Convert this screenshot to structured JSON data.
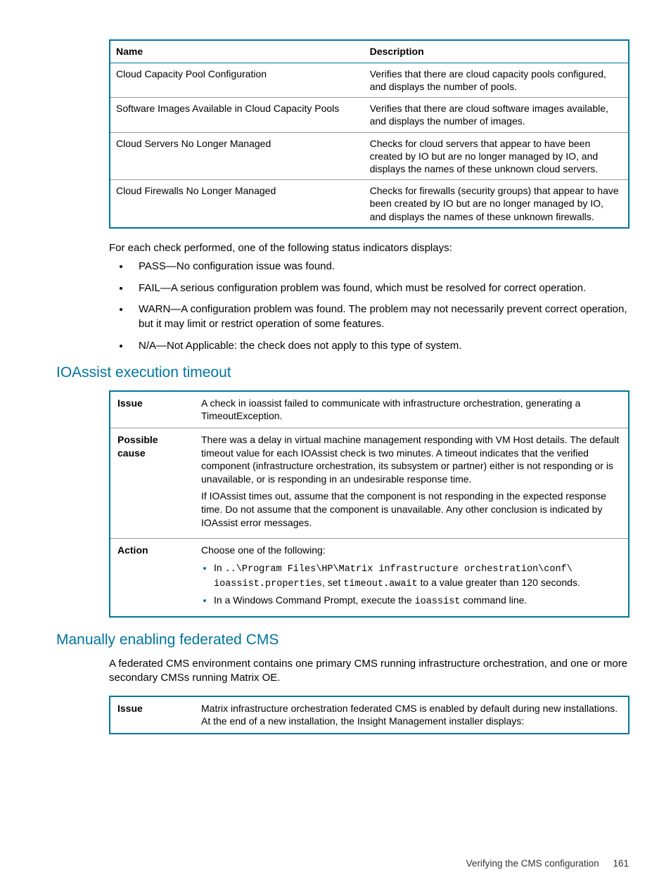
{
  "table1": {
    "header_name": "Name",
    "header_desc": "Description",
    "rows": [
      {
        "name": "Cloud Capacity Pool Configuration",
        "desc": "Verifies that there are cloud capacity pools configured, and displays the number of pools."
      },
      {
        "name": "Software Images Available in Cloud Capacity Pools",
        "desc": "Verifies that there are cloud software images available, and displays the number of images."
      },
      {
        "name": "Cloud Servers No Longer Managed",
        "desc": "Checks for cloud servers that appear to have been created by IO but are no longer managed by IO, and displays the names of these unknown cloud servers."
      },
      {
        "name": "Cloud Firewalls No Longer Managed",
        "desc": "Checks for firewalls (security groups) that appear to have been created by IO but are no longer managed by IO, and displays the names of these unknown firewalls."
      }
    ]
  },
  "para_intro": "For each check performed, one of the following status indicators displays:",
  "statuses": [
    "PASS—No configuration issue was found.",
    "FAIL—A serious configuration problem was found, which must be resolved for correct operation.",
    "WARN—A configuration problem was found. The problem may not necessarily prevent correct operation, but it may limit or restrict operation of some features.",
    "N/A—Not Applicable: the check does not apply to this type of system."
  ],
  "h_timeout": "IOAssist execution timeout",
  "table2": {
    "issue_label": "Issue",
    "issue_text": "A check in ioassist failed to communicate with infrastructure orchestration, generating a TimeoutException.",
    "cause_label": "Possible cause",
    "cause_p1": "There was a delay in virtual machine management responding with VM Host details. The default timeout value for each IOAssist check is two minutes. A timeout indicates that the verified component (infrastructure orchestration, its subsystem or partner) either is not responding or is unavailable, or is responding in an undesirable response time.",
    "cause_p2": "If IOAssist times out, assume that the component is not responding in the expected response time. Do not assume that the component is unavailable. Any other conclusion is indicated by IOAssist error messages.",
    "action_label": "Action",
    "action_intro": "Choose one of the following:",
    "action_b1_pre": "In ",
    "action_b1_code1": "..\\Program Files\\HP\\Matrix infrastructure orchestration\\conf\\ ioassist.properties",
    "action_b1_mid": ", set ",
    "action_b1_code2": "timeout.await",
    "action_b1_post": " to a value greater than 120 seconds.",
    "action_b2_pre": "In a Windows Command Prompt, execute the ",
    "action_b2_code": "ioassist",
    "action_b2_post": " command line."
  },
  "h_cms": "Manually enabling federated CMS",
  "cms_para": "A federated CMS environment contains one primary CMS running infrastructure orchestration, and one or more secondary CMSs running Matrix OE.",
  "table3": {
    "issue_label": "Issue",
    "issue_text": "Matrix infrastructure orchestration federated CMS is enabled by default during new installations. At the end of a new installation, the Insight Management installer displays:"
  },
  "footer_text": "Verifying the CMS configuration",
  "footer_page": "161"
}
